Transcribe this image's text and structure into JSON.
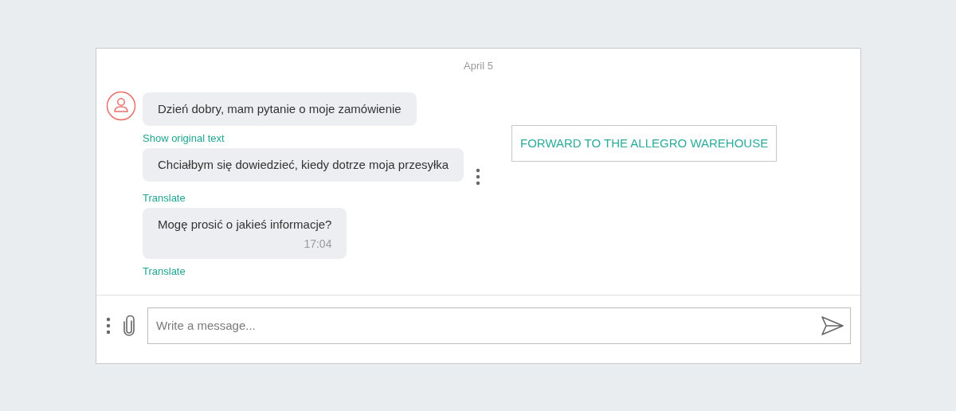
{
  "date": "April 5",
  "messages": [
    {
      "text": "Dzień dobry, mam pytanie o moje zamówienie",
      "link": "Show original text",
      "menu_shown": false
    },
    {
      "text": "Chciałbym się dowiedzieć, kiedy dotrze moja przesyłka",
      "link": "Translate",
      "menu_shown": true
    },
    {
      "text": "Mogę prosić o jakieś informacje?",
      "time": "17:04",
      "link": "Translate",
      "menu_shown": false
    }
  ],
  "menu": {
    "items": [
      "FORWARD TO THE ALLEGRO WAREHOUSE"
    ]
  },
  "composer": {
    "placeholder": "Write a message..."
  }
}
